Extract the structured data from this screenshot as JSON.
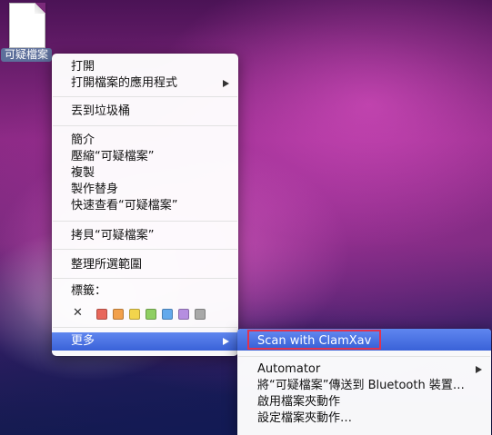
{
  "desktop": {
    "file_label": "可疑檔案"
  },
  "context_menu": {
    "open": "打開",
    "open_with": "打開檔案的應用程式",
    "move_to_trash": "丟到垃圾桶",
    "get_info": "簡介",
    "compress": "壓縮“可疑檔案”",
    "duplicate": "複製",
    "make_alias": "製作替身",
    "quick_look": "快速查看“可疑檔案”",
    "copy": "拷貝“可疑檔案”",
    "clean_up": "整理所選範圍",
    "label_header": "標籤：",
    "label_none_glyph": "✕",
    "label_colors": [
      "#e8675b",
      "#f2a04a",
      "#f2d54c",
      "#8fcf62",
      "#62a9ec",
      "#b58ee0",
      "#a8a8a8"
    ],
    "more": "更多"
  },
  "submenu": {
    "scan": "Scan with ClamXav",
    "automator": "Automator",
    "send_bluetooth": "將“可疑檔案”傳送到 Bluetooth 裝置…",
    "enable_folder_actions": "啟用檔案夾動作",
    "configure_folder_actions": "設定檔案夾動作…"
  }
}
